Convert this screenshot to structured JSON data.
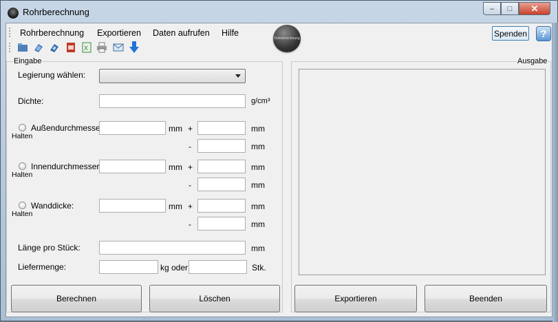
{
  "window": {
    "title": "Rohrberechnung",
    "controls": {
      "minimize": "–",
      "maximize": "□",
      "close": "✕"
    }
  },
  "menu": [
    "Rohrberechnung",
    "Exportieren",
    "Daten aufrufen",
    "Hilfe"
  ],
  "donate_label": "Spenden",
  "help_label": "?",
  "logo_text": "Rohrberechnung",
  "toolbar_icons": [
    "open-icon",
    "save-icon",
    "save-as-icon",
    "pdf-icon",
    "excel-icon",
    "print-icon",
    "mail-icon",
    "download-arrow-icon"
  ],
  "input_group": {
    "title": "Eingabe",
    "alloy_label": "Legierung wählen:",
    "alloy_value": "",
    "density_label": "Dichte:",
    "density_unit": "g/cm³",
    "outer_label": "Außendurchmesser:",
    "inner_label": "Innendurchmesser:",
    "wall_label": "Wanddicke:",
    "hold_label": "Halten",
    "unit_mm": "mm",
    "plus": "+",
    "minus": "-",
    "length_label": "Länge pro Stück:",
    "quantity_label": "Liefermenge:",
    "kg_or": "kg oder",
    "pcs": "Stk."
  },
  "output_group": {
    "title": "Ausgabe"
  },
  "buttons": {
    "calculate": "Berechnen",
    "clear": "Löschen",
    "export": "Exportieren",
    "quit": "Beenden"
  }
}
